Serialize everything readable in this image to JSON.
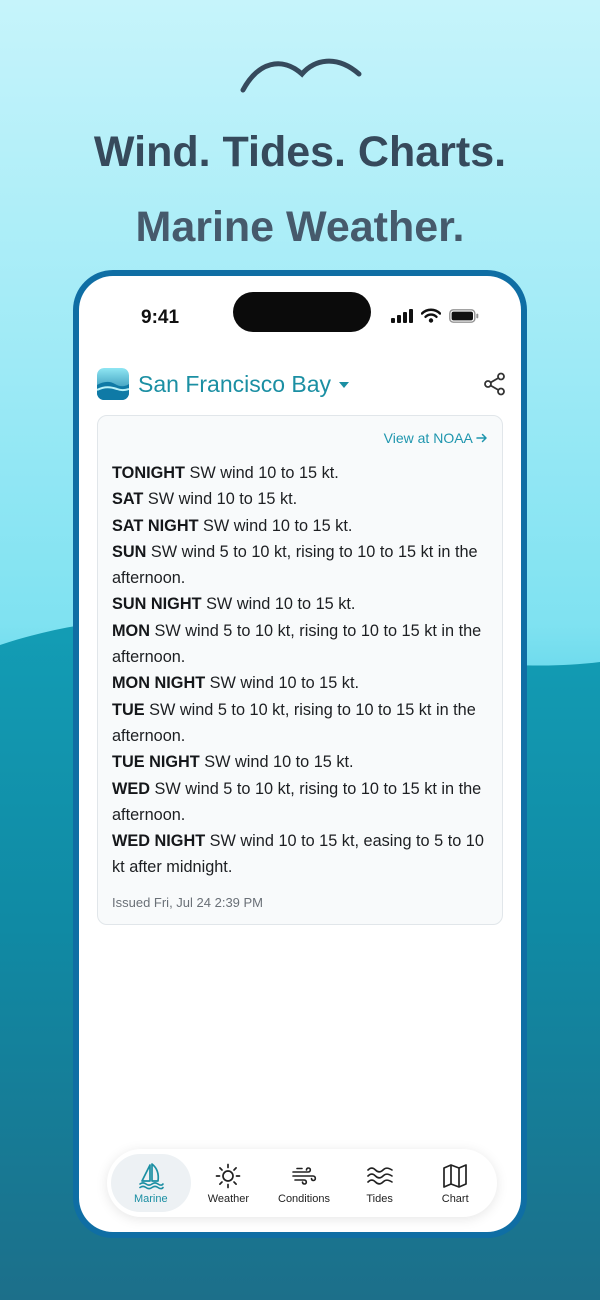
{
  "promo": {
    "headline_line1": "Wind. Tides. Charts.",
    "headline_line2": "Marine Weather."
  },
  "status_bar": {
    "time": "9:41"
  },
  "header": {
    "location": "San Francisco Bay"
  },
  "forecast_card": {
    "link_text": "View at NOAA",
    "periods": [
      {
        "label": "TONIGHT",
        "text": " SW wind 10 to 15 kt."
      },
      {
        "label": "SAT",
        "text": " SW wind 10 to 15 kt."
      },
      {
        "label": "SAT NIGHT",
        "text": " SW wind 10 to 15 kt."
      },
      {
        "label": "SUN",
        "text": " SW wind 5 to 10 kt, rising to 10 to 15 kt in the afternoon."
      },
      {
        "label": "SUN NIGHT",
        "text": " SW wind 10 to 15 kt."
      },
      {
        "label": "MON",
        "text": " SW wind 5 to 10 kt, rising to 10 to 15 kt in the afternoon."
      },
      {
        "label": "MON NIGHT",
        "text": " SW wind 10 to 15 kt."
      },
      {
        "label": "TUE",
        "text": " SW wind 5 to 10 kt, rising to 10 to 15 kt in the afternoon."
      },
      {
        "label": "TUE NIGHT",
        "text": " SW wind 10 to 15 kt."
      },
      {
        "label": "WED",
        "text": " SW wind 5 to 10 kt, rising to 10 to 15 kt in the afternoon."
      },
      {
        "label": "WED NIGHT",
        "text": " SW wind 10 to 15 kt, easing to 5 to 10 kt after midnight."
      }
    ],
    "issued": "Issued Fri, Jul 24 2:39 PM"
  },
  "tabs": [
    {
      "label": "Marine",
      "icon": "sailboat-icon",
      "active": true
    },
    {
      "label": "Weather",
      "icon": "sun-icon",
      "active": false
    },
    {
      "label": "Conditions",
      "icon": "wind-icon",
      "active": false
    },
    {
      "label": "Tides",
      "icon": "waves-icon",
      "active": false
    },
    {
      "label": "Chart",
      "icon": "map-icon",
      "active": false
    }
  ],
  "colors": {
    "accent": "#1b8fa3",
    "phone_frame": "#0f6ea4",
    "headline_dark": "#364a5c"
  }
}
